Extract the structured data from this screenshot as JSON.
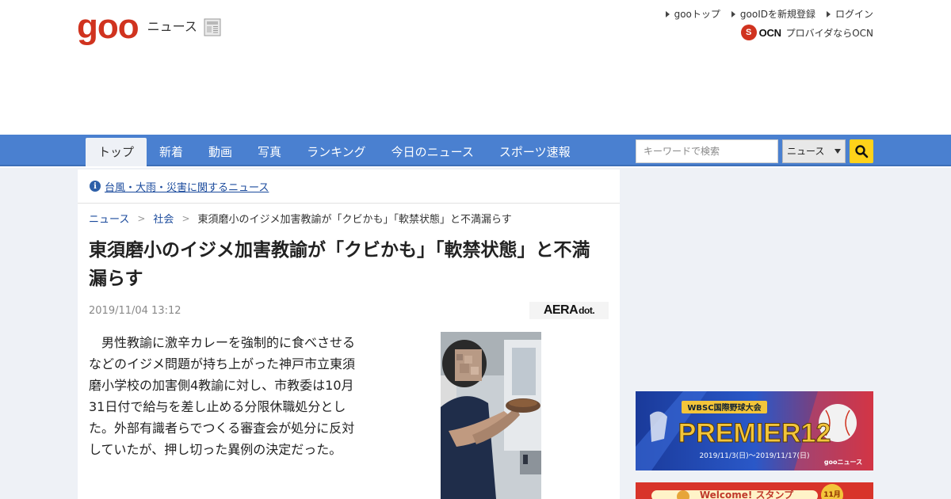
{
  "header": {
    "logo_text": "goo",
    "section_label": "ニュース",
    "links": [
      "gooトップ",
      "gooIDを新規登録",
      "ログイン"
    ],
    "ocn_logo": "OCN",
    "ocn_text": "プロバイダならOCN"
  },
  "nav": {
    "items": [
      "トップ",
      "新着",
      "動画",
      "写真",
      "ランキング",
      "今日のニュース",
      "スポーツ速報"
    ],
    "active_index": 0,
    "search_placeholder": "キーワードで検索",
    "search_scope": "ニュース"
  },
  "notice": {
    "text": "台風・大雨・災害に関するニュース"
  },
  "breadcrumb": {
    "items": [
      "ニュース",
      "社会"
    ],
    "current": "東須磨小のイジメ加害教諭が「クビかも」「軟禁状態」と不満漏らす"
  },
  "article": {
    "headline": "東須磨小のイジメ加害教諭が「クビかも」「軟禁状態」と不満漏らす",
    "date": "2019/11/04 13:12",
    "source": "AERA",
    "source_suffix": "dot.",
    "body": "男性教諭に激辛カレーを強制的に食べさせるなどのイジメ問題が持ち上がった神戸市立東須磨小学校の加害側4教諭に対し、市教委は10月31日付で給与を差し止める分限休職処分とした。外部有識者らでつくる審査会が処分に反対していたが、押し切った異例の決定だった。"
  },
  "sidebar": {
    "banner_premier": {
      "kicker": "WBSC国際野球大会",
      "title": "PREMIER12",
      "dates": "2019/11/3(日)～2019/11/17(日)",
      "brand": "gooニュース"
    },
    "banner_welcome": {
      "text": "Welcome! スタンプ",
      "badge": "11月"
    }
  },
  "colors": {
    "nav_bg": "#4a80d0",
    "goo_red": "#d0331f",
    "link": "#1a4a9c",
    "search_button": "#ffd21a",
    "page_bg": "#eef1f6"
  },
  "icons": {
    "search": "magnifier-icon",
    "info": "info-icon",
    "newspaper": "newspaper-icon"
  }
}
